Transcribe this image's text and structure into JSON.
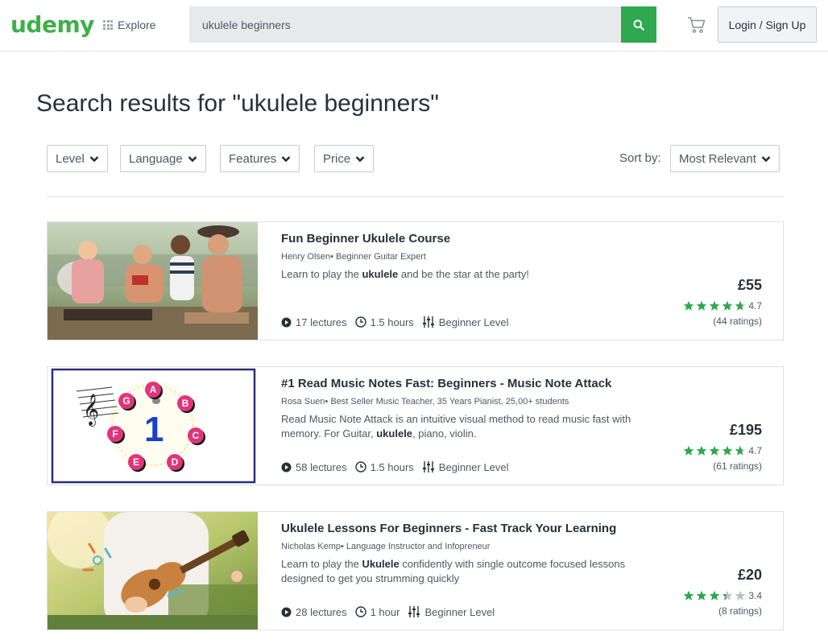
{
  "header": {
    "logo": "udemy",
    "explore_label": "Explore",
    "search_value": "ukulele beginners",
    "login_label": "Login / Sign Up"
  },
  "page_title": "Search results for \"ukulele beginners\"",
  "filters": {
    "level": "Level",
    "language": "Language",
    "features": "Features",
    "price": "Price",
    "sort_label": "Sort by:",
    "sort_value": "Most Relevant"
  },
  "courses": [
    {
      "title": "Fun Beginner Ukulele Course",
      "instructor": "Henry Olsen• Beginner Guitar Expert",
      "desc_pre": "Learn to play the ",
      "desc_bold": "ukulele",
      "desc_post": " and be the star at the party!",
      "lectures": "17 lectures",
      "duration": "1.5 hours",
      "level": "Beginner Level",
      "price": "£55",
      "rating": "4.7",
      "rating_value": 4.7,
      "ratings_count": "(44 ratings)"
    },
    {
      "title": "#1 Read Music Notes Fast: Beginners - Music Note Attack",
      "instructor": "Rosa Suen• Best Seller Music Teacher, 35 Years Pianist, 25,00+ students",
      "desc_pre": "Read Music Note Attack is an intuitive visual method to read music fast with memory. For Guitar, ",
      "desc_bold": "ukulele",
      "desc_post": ", piano, violin.",
      "lectures": "58 lectures",
      "duration": "1.5 hours",
      "level": "Beginner Level",
      "price": "£195",
      "rating": "4.7",
      "rating_value": 4.7,
      "ratings_count": "(61 ratings)",
      "note_labels": [
        "A",
        "B",
        "C",
        "D",
        "E",
        "F",
        "G"
      ],
      "center_number": "1"
    },
    {
      "title": "Ukulele Lessons For Beginners - Fast Track Your Learning",
      "instructor": "Nicholas Kemp• Language Instructor and Infopreneur",
      "desc_pre": "Learn to play the ",
      "desc_bold": "Ukulele",
      "desc_post": " confidently with single outcome focused lessons designed to get you strumming quickly",
      "lectures": "28 lectures",
      "duration": "1 hour",
      "level": "Beginner Level",
      "price": "£20",
      "rating": "3.4",
      "rating_value": 3.4,
      "ratings_count": "(8 ratings)"
    }
  ],
  "colors": {
    "brand": "#3db04a",
    "search_button": "#2fa84f",
    "star": "#2fa84f",
    "star_empty": "#bfc2c7"
  },
  "icons": [
    "grid-icon",
    "search-icon",
    "cart-icon",
    "chevron-down-icon",
    "play-circle-icon",
    "clock-icon",
    "level-bars-icon",
    "star-icon"
  ]
}
